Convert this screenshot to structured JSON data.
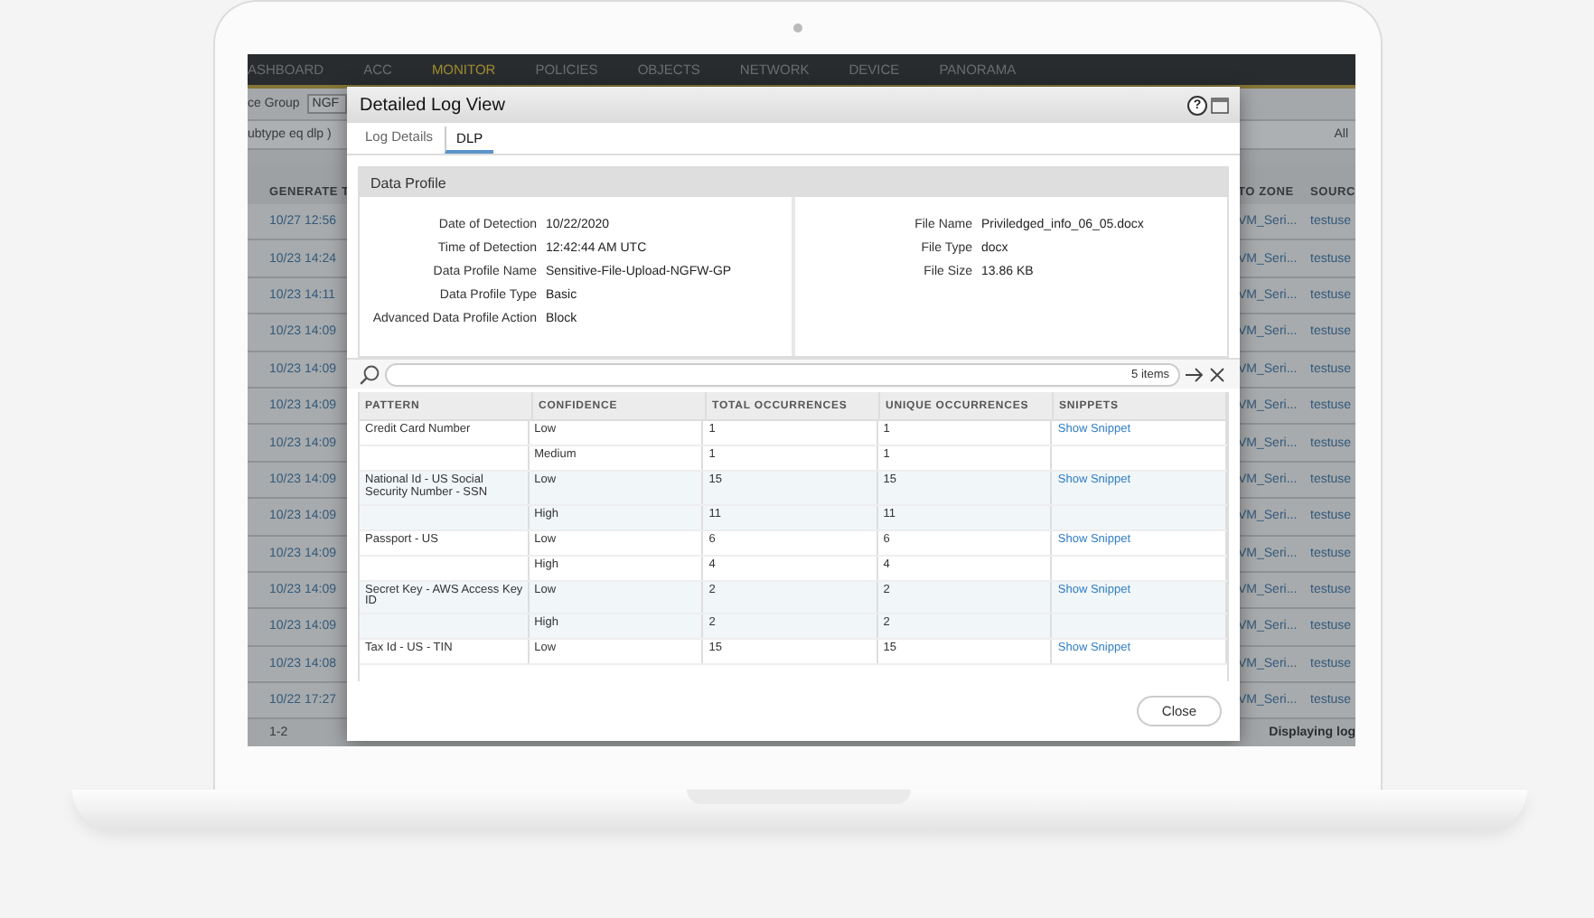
{
  "nav": [
    {
      "label": "ASHBOARD",
      "selected": false
    },
    {
      "label": "ACC",
      "selected": false
    },
    {
      "label": "MONITOR",
      "selected": true
    },
    {
      "label": "POLICIES",
      "selected": false
    },
    {
      "label": "OBJECTS",
      "selected": false
    },
    {
      "label": "NETWORK",
      "selected": false
    },
    {
      "label": "DEVICE",
      "selected": false
    },
    {
      "label": "PANORAMA",
      "selected": false
    }
  ],
  "toolbar": {
    "label": "ce Group",
    "value": "NGF"
  },
  "filter": {
    "query": "ubtype eq dlp )",
    "scope": "All"
  },
  "log_table": {
    "columns": [
      "GENERATE T",
      "TO ZONE",
      "SOURC"
    ],
    "rows": [
      [
        "10/27 12:56",
        "VM_Seri...",
        "testuse"
      ],
      [
        "10/23 14:24",
        "VM_Seri...",
        "testuse"
      ],
      [
        "10/23 14:11",
        "VM_Seri...",
        "testuse"
      ],
      [
        "10/23 14:09",
        "VM_Seri...",
        "testuse"
      ],
      [
        "10/23 14:09",
        "VM_Seri...",
        "testuse"
      ],
      [
        "10/23 14:09",
        "VM_Seri...",
        "testuse"
      ],
      [
        "10/23 14:09",
        "VM_Seri...",
        "testuse"
      ],
      [
        "10/23 14:09",
        "VM_Seri...",
        "testuse"
      ],
      [
        "10/23 14:09",
        "VM_Seri...",
        "testuse"
      ],
      [
        "10/23 14:09",
        "VM_Seri...",
        "testuse"
      ],
      [
        "10/23 14:09",
        "VM_Seri...",
        "testuse"
      ],
      [
        "10/23 14:09",
        "VM_Seri...",
        "testuse"
      ],
      [
        "10/23 14:08",
        "VM_Seri...",
        "testuse"
      ],
      [
        "10/22 17:27",
        "VM_Seri...",
        "testuse"
      ]
    ]
  },
  "pager": {
    "range": "1-2",
    "status": "Displaying log"
  },
  "dialog": {
    "title": "Detailed Log View",
    "help": "?",
    "tabs": [
      {
        "label": "Log Details",
        "selected": false
      },
      {
        "label": "DLP",
        "selected": true
      }
    ],
    "section": "Data Profile",
    "details_left": [
      {
        "label": "Date of Detection",
        "value": "10/22/2020"
      },
      {
        "label": "Time of Detection",
        "value": "12:42:44 AM UTC"
      },
      {
        "label": "Data Profile Name",
        "value": "Sensitive-File-Upload-NGFW-GP"
      },
      {
        "label": "Data Profile Type",
        "value": "Basic"
      },
      {
        "label": "Advanced Data Profile Action",
        "value": "Block"
      }
    ],
    "details_right": [
      {
        "label": "File Name",
        "value": "Priviledged_info_06_05.docx"
      },
      {
        "label": "File Type",
        "value": "docx"
      },
      {
        "label": "File Size",
        "value": "13.86 KB"
      }
    ],
    "search": {
      "count": "5 items"
    },
    "columns": [
      "PATTERN",
      "CONFIDENCE",
      "TOTAL OCCURRENCES",
      "UNIQUE OCCURRENCES",
      "SNIPPETS"
    ],
    "groups": [
      {
        "pattern": "Credit Card Number",
        "snippet": "Show Snippet",
        "rows": [
          {
            "confidence": "Low",
            "total": "1",
            "unique": "1"
          },
          {
            "confidence": "Medium",
            "total": "1",
            "unique": "1"
          }
        ]
      },
      {
        "pattern": "National Id - US Social Security Number - SSN",
        "snippet": "Show Snippet",
        "rows": [
          {
            "confidence": "Low",
            "total": "15",
            "unique": "15"
          },
          {
            "confidence": "High",
            "total": "11",
            "unique": "11"
          }
        ]
      },
      {
        "pattern": "Passport - US",
        "snippet": "Show Snippet",
        "rows": [
          {
            "confidence": "Low",
            "total": "6",
            "unique": "6"
          },
          {
            "confidence": "High",
            "total": "4",
            "unique": "4"
          }
        ]
      },
      {
        "pattern": "Secret Key - AWS Access Key ID",
        "snippet": "Show Snippet",
        "rows": [
          {
            "confidence": "Low",
            "total": "2",
            "unique": "2"
          },
          {
            "confidence": "High",
            "total": "2",
            "unique": "2"
          }
        ]
      },
      {
        "pattern": "Tax Id - US - TIN",
        "snippet": "Show Snippet",
        "rows": [
          {
            "confidence": "Low",
            "total": "15",
            "unique": "15"
          }
        ]
      }
    ],
    "close": "Close"
  }
}
